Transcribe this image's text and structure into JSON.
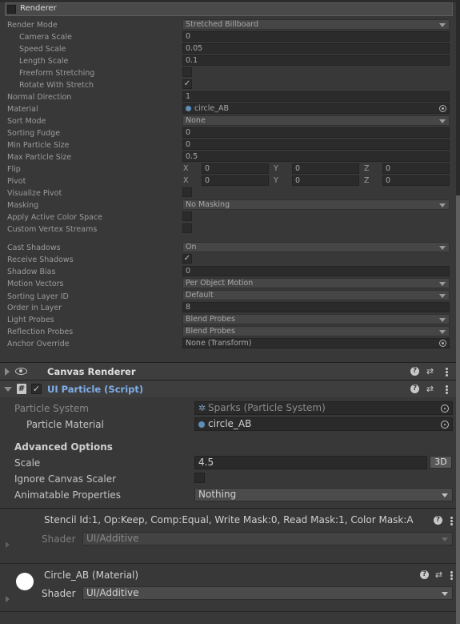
{
  "renderer": {
    "header": "Renderer",
    "rows": {
      "render_mode": {
        "label": "Render Mode",
        "value": "Stretched Billboard"
      },
      "camera_scale": {
        "label": "Camera Scale",
        "value": "0"
      },
      "speed_scale": {
        "label": "Speed Scale",
        "value": "0.05"
      },
      "length_scale": {
        "label": "Length Scale",
        "value": "0.1"
      },
      "freeform_stretching": {
        "label": "Freeform Stretching",
        "checked": false
      },
      "rotate_with_stretch": {
        "label": "Rotate With Stretch",
        "checked": true,
        "check": "✓"
      },
      "normal_direction": {
        "label": "Normal Direction",
        "value": "1"
      },
      "material": {
        "label": "Material",
        "value": "circle_AB"
      },
      "sort_mode": {
        "label": "Sort Mode",
        "value": "None"
      },
      "sorting_fudge": {
        "label": "Sorting Fudge",
        "value": "0"
      },
      "min_particle_size": {
        "label": "Min Particle Size",
        "value": "0"
      },
      "max_particle_size": {
        "label": "Max Particle Size",
        "value": "0.5"
      },
      "flip": {
        "label": "Flip",
        "x": "0",
        "y": "0",
        "z": "0"
      },
      "pivot": {
        "label": "Pivot",
        "x": "0",
        "y": "0",
        "z": "0"
      },
      "visualize_pivot": {
        "label": "Visualize Pivot",
        "checked": false
      },
      "masking": {
        "label": "Masking",
        "value": "No Masking"
      },
      "apply_active_color_space": {
        "label": "Apply Active Color Space",
        "checked": false
      },
      "custom_vertex_streams": {
        "label": "Custom Vertex Streams",
        "checked": false
      },
      "cast_shadows": {
        "label": "Cast Shadows",
        "value": "On"
      },
      "receive_shadows": {
        "label": "Receive Shadows",
        "checked": true,
        "check": "✓"
      },
      "shadow_bias": {
        "label": "Shadow Bias",
        "value": "0"
      },
      "motion_vectors": {
        "label": "Motion Vectors",
        "value": "Per Object Motion"
      },
      "sorting_layer_id": {
        "label": "Sorting Layer ID",
        "value": "Default"
      },
      "order_in_layer": {
        "label": "Order in Layer",
        "value": "8"
      },
      "light_probes": {
        "label": "Light Probes",
        "value": "Blend Probes"
      },
      "reflection_probes": {
        "label": "Reflection Probes",
        "value": "Blend Probes"
      },
      "anchor_override": {
        "label": "Anchor Override",
        "value": "None (Transform)"
      }
    },
    "axis_labels": {
      "x": "X",
      "y": "Y",
      "z": "Z"
    }
  },
  "canvas_renderer": {
    "title": "Canvas Renderer"
  },
  "ui_particle": {
    "title": "UI Particle (Script)",
    "hash_glyph": "#",
    "enabled_check": "✓",
    "particle_system": {
      "label": "Particle System",
      "value": "Sparks (Particle System)"
    },
    "particle_material": {
      "label": "Particle Material",
      "value": "circle_AB"
    },
    "advanced_options": "Advanced Options",
    "scale": {
      "label": "Scale",
      "value": "4.5",
      "mode_button": "3D"
    },
    "ignore_canvas_scaler": {
      "label": "Ignore Canvas Scaler",
      "checked": false
    },
    "animatable_properties": {
      "label": "Animatable Properties",
      "value": "Nothing"
    }
  },
  "stencil_material": {
    "title": "Stencil Id:1, Op:Keep, Comp:Equal, Write Mask:0, Read Mask:1, Color Mask:A",
    "shader_label": "Shader",
    "shader_value": "UI/Additive"
  },
  "circle_material": {
    "title": "Circle_AB (Material)",
    "shader_label": "Shader",
    "shader_value": "UI/Additive"
  },
  "header_icons": {
    "help": "?",
    "presets": "⇄"
  },
  "colors": {
    "background": "#383838",
    "field": "#2b2b2b",
    "script_title": "#7faee8",
    "object_dot": "#5c8fb8"
  }
}
